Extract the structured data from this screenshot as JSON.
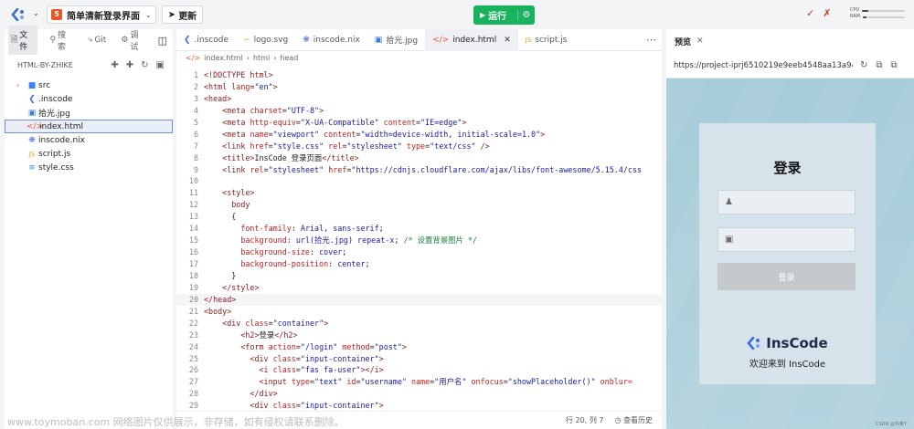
{
  "topbar": {
    "project_name": "简单清新登录界面",
    "update_label": "更新",
    "run_label": "运行",
    "meters": [
      {
        "label": "CPU",
        "fraction": 0.15
      },
      {
        "label": "RAM",
        "fraction": 0.08
      }
    ]
  },
  "sidebar": {
    "tabs": [
      {
        "icon": "file-icon",
        "label": "文件"
      },
      {
        "icon": "search-icon",
        "label": "搜索"
      },
      {
        "icon": "git-icon",
        "label": "Git"
      },
      {
        "icon": "debug-icon",
        "label": "调试"
      }
    ],
    "explorer_title": "HTML-BY-ZHIKE",
    "files": [
      {
        "name": "src",
        "type": "folder",
        "color": "#3b82f6"
      },
      {
        "name": ".inscode",
        "type": "inscode",
        "color": "#3b6fd6"
      },
      {
        "name": "拾光.jpg",
        "type": "image",
        "color": "#2f7fd6"
      },
      {
        "name": "index.html",
        "type": "html",
        "color": "#e8572a",
        "selected": true
      },
      {
        "name": "inscode.nix",
        "type": "nix",
        "color": "#4a6fd1"
      },
      {
        "name": "script.js",
        "type": "js",
        "color": "#d4a017"
      },
      {
        "name": "style.css",
        "type": "css",
        "color": "#3a8ddf"
      }
    ]
  },
  "editor": {
    "tabs": [
      {
        "label": ".inscode",
        "icon": "inscode-icon",
        "color": "#3b6fd6"
      },
      {
        "label": "logo.svg",
        "icon": "svg-icon",
        "color": "#d4a017"
      },
      {
        "label": "inscode.nix",
        "icon": "nix-icon",
        "color": "#4a6fd1"
      },
      {
        "label": "拾光.jpg",
        "icon": "image-icon",
        "color": "#2f7fd6"
      },
      {
        "label": "index.html",
        "icon": "html-icon",
        "color": "#e8572a",
        "active": true
      },
      {
        "label": "script.js",
        "icon": "js-icon",
        "color": "#d4a017"
      }
    ],
    "breadcrumb": [
      "index.html",
      "html",
      "head"
    ],
    "lines": [
      [
        [
          "tg",
          "<!DOCTYPE html>"
        ]
      ],
      [
        [
          "tg",
          "<html "
        ],
        [
          "at",
          "lang"
        ],
        [
          "txt",
          "="
        ],
        [
          "st",
          "\"en\""
        ],
        [
          "tg",
          ">"
        ]
      ],
      [
        [
          "tg",
          "<head>"
        ]
      ],
      [
        [
          "txt",
          "    "
        ],
        [
          "tg",
          "<meta "
        ],
        [
          "at",
          "charset"
        ],
        [
          "txt",
          "="
        ],
        [
          "st",
          "\"UTF-8\""
        ],
        [
          "tg",
          ">"
        ]
      ],
      [
        [
          "txt",
          "    "
        ],
        [
          "tg",
          "<meta "
        ],
        [
          "at",
          "http-equiv"
        ],
        [
          "txt",
          "="
        ],
        [
          "st",
          "\"X-UA-Compatible\""
        ],
        [
          "txt",
          " "
        ],
        [
          "at",
          "content"
        ],
        [
          "txt",
          "="
        ],
        [
          "st",
          "\"IE=edge\""
        ],
        [
          "tg",
          ">"
        ]
      ],
      [
        [
          "txt",
          "    "
        ],
        [
          "tg",
          "<meta "
        ],
        [
          "at",
          "name"
        ],
        [
          "txt",
          "="
        ],
        [
          "st",
          "\"viewport\""
        ],
        [
          "txt",
          " "
        ],
        [
          "at",
          "content"
        ],
        [
          "txt",
          "="
        ],
        [
          "st",
          "\"width=device-width, initial-scale=1.0\""
        ],
        [
          "tg",
          ">"
        ]
      ],
      [
        [
          "txt",
          "    "
        ],
        [
          "tg",
          "<link "
        ],
        [
          "at",
          "href"
        ],
        [
          "txt",
          "="
        ],
        [
          "st",
          "\"style.css\""
        ],
        [
          "txt",
          " "
        ],
        [
          "at",
          "rel"
        ],
        [
          "txt",
          "="
        ],
        [
          "st",
          "\"stylesheet\""
        ],
        [
          "txt",
          " "
        ],
        [
          "at",
          "type"
        ],
        [
          "txt",
          "="
        ],
        [
          "st",
          "\"text/css\""
        ],
        [
          "tg",
          " />"
        ]
      ],
      [
        [
          "txt",
          "    "
        ],
        [
          "tg",
          "<title>"
        ],
        [
          "txt",
          "InsCode 登录页面"
        ],
        [
          "tg",
          "</title>"
        ]
      ],
      [
        [
          "txt",
          "    "
        ],
        [
          "tg",
          "<link "
        ],
        [
          "at",
          "rel"
        ],
        [
          "txt",
          "="
        ],
        [
          "st",
          "\"stylesheet\""
        ],
        [
          "txt",
          " "
        ],
        [
          "at",
          "href"
        ],
        [
          "txt",
          "="
        ],
        [
          "st",
          "\"https://cdnjs.cloudflare.com/ajax/libs/font-awesome/5.15.4/css"
        ]
      ],
      [
        [
          "txt",
          ""
        ]
      ],
      [
        [
          "txt",
          "    "
        ],
        [
          "tg",
          "<style>"
        ]
      ],
      [
        [
          "txt",
          "      "
        ],
        [
          "tg",
          "body"
        ]
      ],
      [
        [
          "txt",
          "      {"
        ]
      ],
      [
        [
          "txt",
          "        "
        ],
        [
          "pr",
          "font-family"
        ],
        [
          "txt",
          ": "
        ],
        [
          "vl",
          "Arial, sans-serif"
        ],
        [
          "txt",
          ";"
        ]
      ],
      [
        [
          "txt",
          "        "
        ],
        [
          "pr",
          "background"
        ],
        [
          "txt",
          ": "
        ],
        [
          "vl",
          "url(拾光.jpg) repeat-x"
        ],
        [
          "txt",
          "; "
        ],
        [
          "cm",
          "/* 设置背景图片 */"
        ]
      ],
      [
        [
          "txt",
          "        "
        ],
        [
          "pr",
          "background-size"
        ],
        [
          "txt",
          ": "
        ],
        [
          "vl",
          "cover"
        ],
        [
          "txt",
          ";"
        ]
      ],
      [
        [
          "txt",
          "        "
        ],
        [
          "pr",
          "background-position"
        ],
        [
          "txt",
          ": "
        ],
        [
          "vl",
          "center"
        ],
        [
          "txt",
          ";"
        ]
      ],
      [
        [
          "txt",
          "      }"
        ]
      ],
      [
        [
          "txt",
          "    "
        ],
        [
          "tg",
          "</style>"
        ]
      ],
      [
        [
          "tg",
          "</head>"
        ]
      ],
      [
        [
          "tg",
          "<body>"
        ]
      ],
      [
        [
          "txt",
          "    "
        ],
        [
          "tg",
          "<div "
        ],
        [
          "at",
          "class"
        ],
        [
          "txt",
          "="
        ],
        [
          "st",
          "\"container\""
        ],
        [
          "tg",
          ">"
        ]
      ],
      [
        [
          "txt",
          "        "
        ],
        [
          "tg",
          "<h2>"
        ],
        [
          "txt",
          "登录"
        ],
        [
          "tg",
          "</h2>"
        ]
      ],
      [
        [
          "txt",
          "        "
        ],
        [
          "tg",
          "<form "
        ],
        [
          "at",
          "action"
        ],
        [
          "txt",
          "="
        ],
        [
          "st",
          "\"/login\""
        ],
        [
          "txt",
          " "
        ],
        [
          "at",
          "method"
        ],
        [
          "txt",
          "="
        ],
        [
          "st",
          "\"post\""
        ],
        [
          "tg",
          ">"
        ]
      ],
      [
        [
          "txt",
          "          "
        ],
        [
          "tg",
          "<div "
        ],
        [
          "at",
          "class"
        ],
        [
          "txt",
          "="
        ],
        [
          "st",
          "\"input-container\""
        ],
        [
          "tg",
          ">"
        ]
      ],
      [
        [
          "txt",
          "            "
        ],
        [
          "tg",
          "<i "
        ],
        [
          "at",
          "class"
        ],
        [
          "txt",
          "="
        ],
        [
          "st",
          "\"fas fa-user\""
        ],
        [
          "tg",
          "></i>"
        ]
      ],
      [
        [
          "txt",
          "            "
        ],
        [
          "tg",
          "<input "
        ],
        [
          "at",
          "type"
        ],
        [
          "txt",
          "="
        ],
        [
          "st",
          "\"text\""
        ],
        [
          "txt",
          " "
        ],
        [
          "at",
          "id"
        ],
        [
          "txt",
          "="
        ],
        [
          "st",
          "\"username\""
        ],
        [
          "txt",
          " "
        ],
        [
          "at",
          "name"
        ],
        [
          "txt",
          "="
        ],
        [
          "st",
          "\"用户名\""
        ],
        [
          "txt",
          " "
        ],
        [
          "at",
          "onfocus"
        ],
        [
          "txt",
          "="
        ],
        [
          "st",
          "\"showPlaceholder()\""
        ],
        [
          "txt",
          " "
        ],
        [
          "at",
          "onblur="
        ]
      ],
      [
        [
          "txt",
          "          "
        ],
        [
          "tg",
          "</div>"
        ]
      ],
      [
        [
          "txt",
          "          "
        ],
        [
          "tg",
          "<div "
        ],
        [
          "at",
          "class"
        ],
        [
          "txt",
          "="
        ],
        [
          "st",
          "\"input-container\""
        ],
        [
          "tg",
          ">"
        ]
      ]
    ],
    "current_line": 20,
    "status": {
      "position": "行 20, 列 7",
      "history": "查看历史"
    }
  },
  "preview": {
    "tab_label": "预览",
    "url": "https://project-iprj6510219e9eeb4548aa13a94",
    "login_title": "登录",
    "login_button": "登录",
    "brand_name": "InsCode",
    "welcome_text": "欢迎来到 InsCode"
  },
  "watermark": "www.toymoban.com 网络图片仅供展示，非存储，如有侵权请联系删除。",
  "corner_mark": "CSDN @许某Y"
}
